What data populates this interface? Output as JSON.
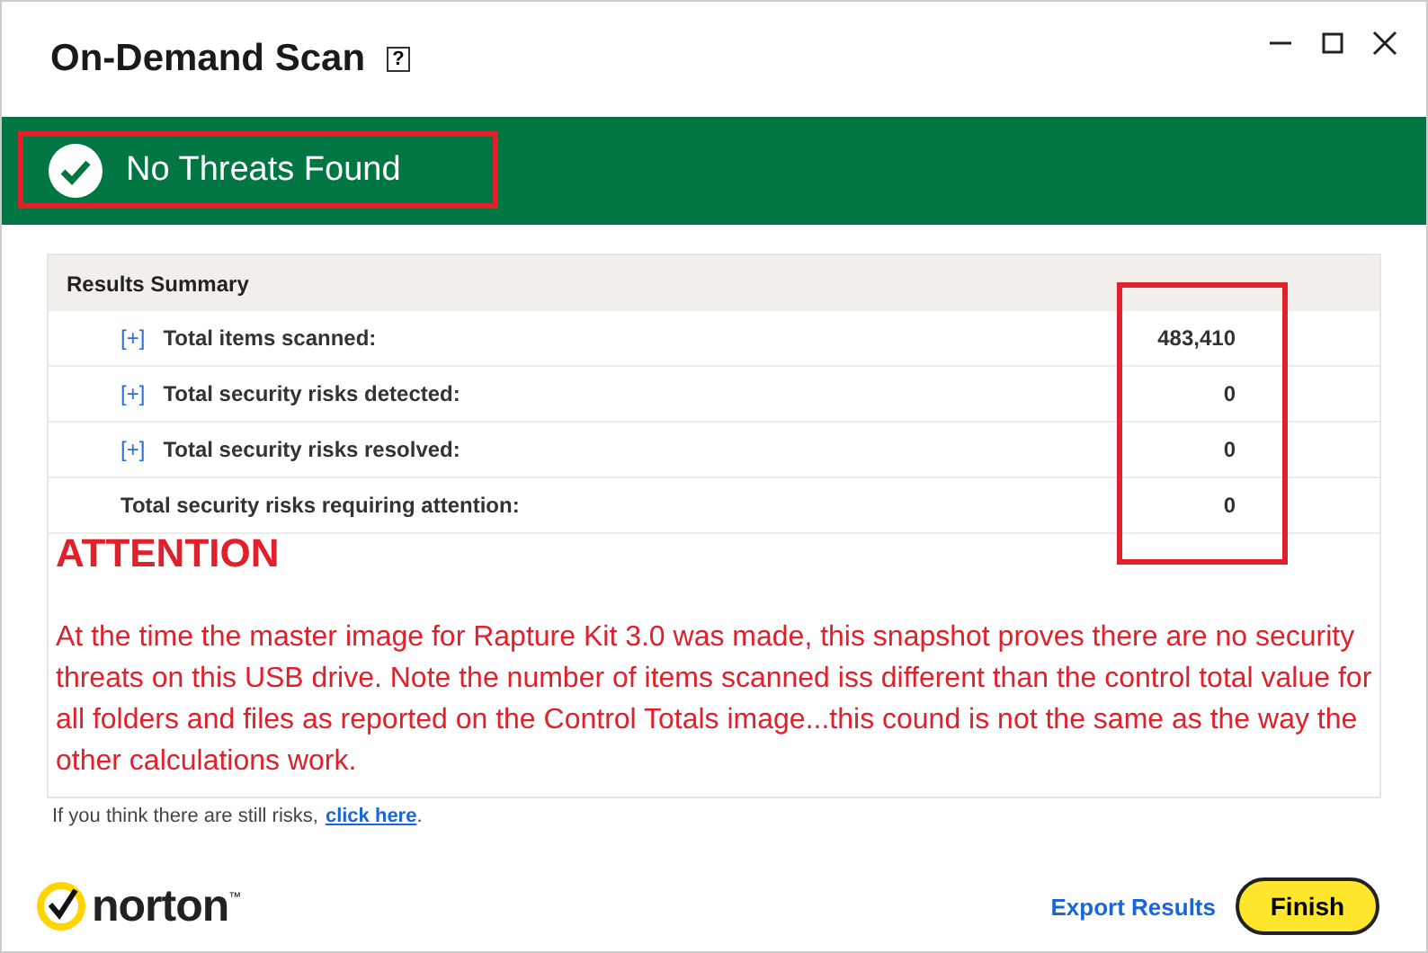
{
  "window": {
    "title": "On-Demand Scan",
    "help": "?"
  },
  "banner": {
    "status": "No Threats Found",
    "highlighted": true
  },
  "summary": {
    "title": "Results Summary",
    "values_highlighted": true,
    "rows": [
      {
        "toggle": "[+]",
        "label": "Total items scanned:",
        "value": "483,410"
      },
      {
        "toggle": "[+]",
        "label": "Total security risks detected:",
        "value": "0"
      },
      {
        "toggle": "[+]",
        "label": "Total security risks resolved:",
        "value": "0"
      },
      {
        "label": "Total security risks requiring attention:",
        "value": "0"
      }
    ],
    "note_heading": "ATTENTION",
    "note": "At the time the master image for Rapture Kit 3.0 was made, this snapshot proves there are no security threats on this USB drive.  Note the number of items scanned iss different than the control total value for all folders and files as reported on the Control Totals image...this cound is not the same as the way the other calculations work."
  },
  "hint": {
    "text": "If you think there are still risks,",
    "link": "click here",
    "end": "."
  },
  "footer": {
    "brand": "norton",
    "trademark": "™",
    "export": "Export Results",
    "finish": "Finish"
  }
}
